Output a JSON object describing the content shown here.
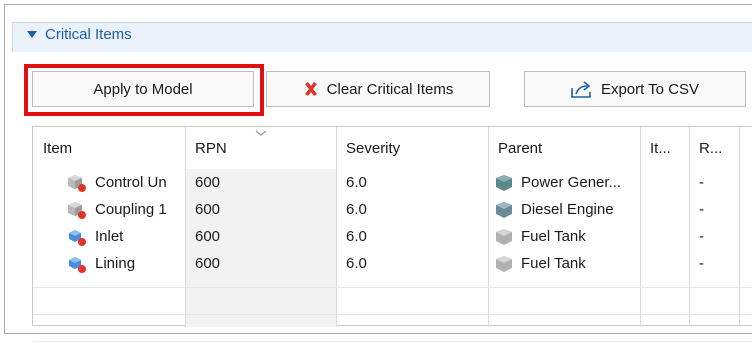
{
  "section": {
    "title": "Critical Items"
  },
  "buttons": {
    "apply": "Apply to Model",
    "clear": "Clear Critical Items",
    "export": "Export To CSV"
  },
  "table": {
    "headers": {
      "item": "Item",
      "rpn": "RPN",
      "severity": "Severity",
      "parent": "Parent",
      "it": "It...",
      "r": "R..."
    },
    "rows": [
      {
        "item": "Control Un",
        "rpn": "600",
        "severity": "6.0",
        "parent": "Power Gener...",
        "r": "-"
      },
      {
        "item": "Coupling 1",
        "rpn": "600",
        "severity": "6.0",
        "parent": "Diesel Engine",
        "r": "-"
      },
      {
        "item": "Inlet",
        "rpn": "600",
        "severity": "6.0",
        "parent": "Fuel Tank",
        "r": "-"
      },
      {
        "item": "Lining",
        "rpn": "600",
        "severity": "6.0",
        "parent": "Fuel Tank",
        "r": "-"
      }
    ]
  },
  "icons": [
    "collapse-triangle-icon",
    "clear-x-icon",
    "export-icon",
    "component-cube-icon",
    "parent-cube-icon",
    "sort-chevron-icon"
  ],
  "colors": {
    "accent": "#1c5fa7",
    "highlight": "#e01010",
    "clear_icon": "#e0342a"
  }
}
